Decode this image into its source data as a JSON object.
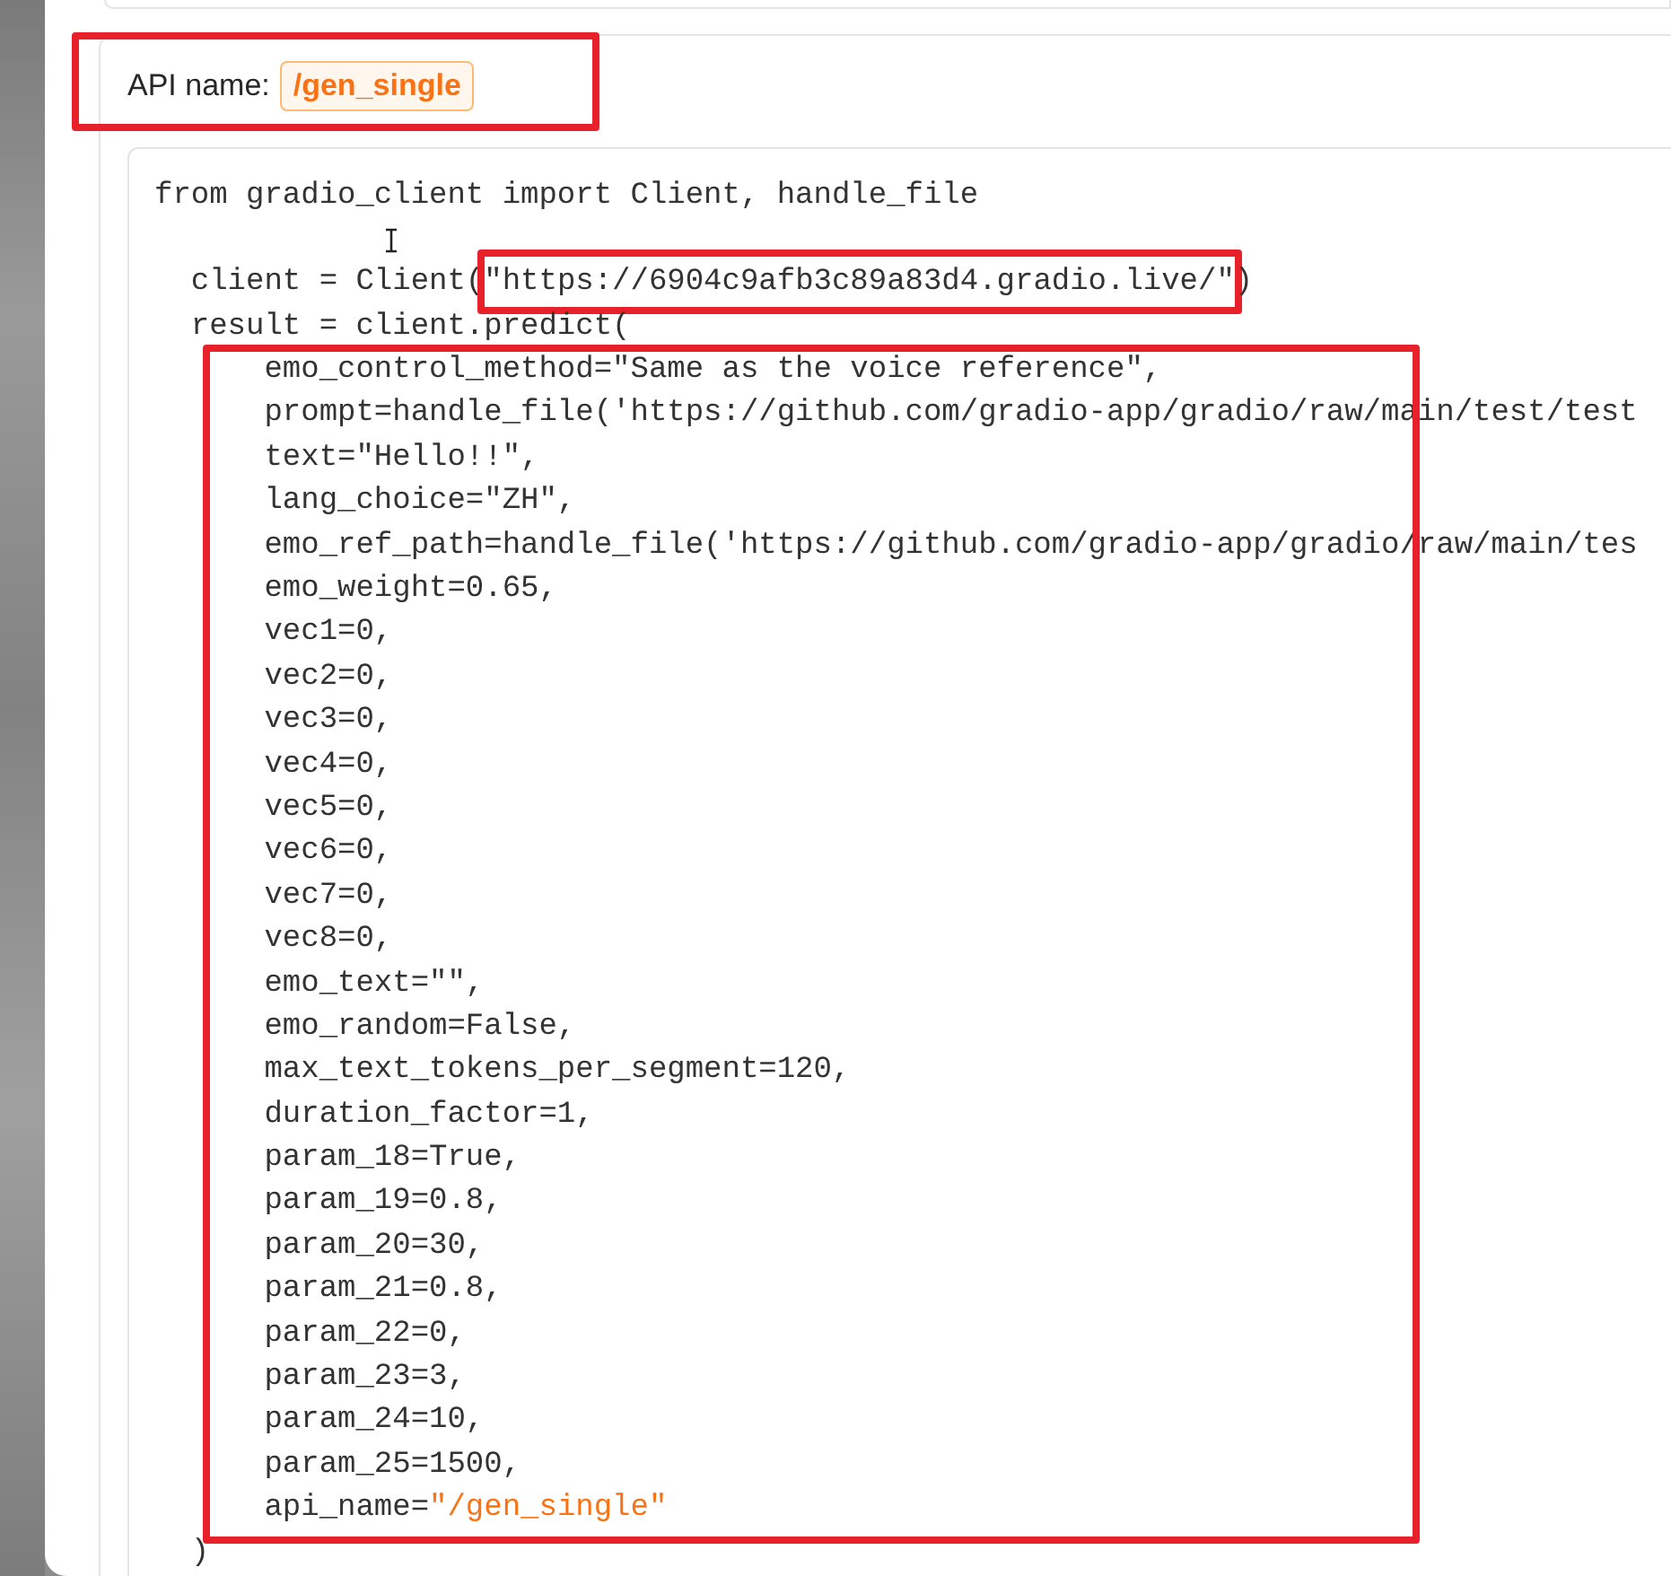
{
  "api_name": {
    "label": "API name:",
    "badge": "/gen_single"
  },
  "code": [
    {
      "kind": "stmt",
      "text": "from gradio_client import Client, handle_file"
    },
    {
      "kind": "blank"
    },
    {
      "kind": "stmt",
      "text": "  client = Client(",
      "url": "\"https://6904c9afb3c89a83d4.gradio.live/\"",
      "tail": ")"
    },
    {
      "kind": "stmt",
      "text": "  result = client.predict("
    },
    {
      "kind": "arg",
      "text": "      emo_control_method=\"Same as the voice reference\","
    },
    {
      "kind": "arg",
      "text": "      prompt=handle_file('https://github.com/gradio-app/gradio/raw/main/test/test"
    },
    {
      "kind": "arg",
      "text": "      text=\"Hello!!\","
    },
    {
      "kind": "arg",
      "text": "      lang_choice=\"ZH\","
    },
    {
      "kind": "arg",
      "text": "      emo_ref_path=handle_file('https://github.com/gradio-app/gradio/raw/main/tes"
    },
    {
      "kind": "arg",
      "text": "      emo_weight=0.65,"
    },
    {
      "kind": "arg",
      "text": "      vec1=0,"
    },
    {
      "kind": "arg",
      "text": "      vec2=0,"
    },
    {
      "kind": "arg",
      "text": "      vec3=0,"
    },
    {
      "kind": "arg",
      "text": "      vec4=0,"
    },
    {
      "kind": "arg",
      "text": "      vec5=0,"
    },
    {
      "kind": "arg",
      "text": "      vec6=0,"
    },
    {
      "kind": "arg",
      "text": "      vec7=0,"
    },
    {
      "kind": "arg",
      "text": "      vec8=0,"
    },
    {
      "kind": "arg",
      "text": "      emo_text=\"\","
    },
    {
      "kind": "arg",
      "text": "      emo_random=False,"
    },
    {
      "kind": "arg",
      "text": "      max_text_tokens_per_segment=120,"
    },
    {
      "kind": "arg",
      "text": "      duration_factor=1,"
    },
    {
      "kind": "arg",
      "text": "      param_18=True,"
    },
    {
      "kind": "arg",
      "text": "      param_19=0.8,"
    },
    {
      "kind": "arg",
      "text": "      param_20=30,"
    },
    {
      "kind": "arg",
      "text": "      param_21=0.8,"
    },
    {
      "kind": "arg",
      "text": "      param_22=0,"
    },
    {
      "kind": "arg",
      "text": "      param_23=3,"
    },
    {
      "kind": "arg",
      "text": "      param_24=10,"
    },
    {
      "kind": "arg",
      "text": "      param_25=1500,"
    },
    {
      "kind": "arg",
      "text": "      api_name=",
      "string": "\"/gen_single\""
    },
    {
      "kind": "stmt",
      "text": "  )"
    }
  ],
  "highlights": [
    {
      "kind": "api-name"
    },
    {
      "kind": "client-url"
    },
    {
      "kind": "arguments"
    }
  ],
  "pointer": {
    "kind": "text-beam"
  }
}
